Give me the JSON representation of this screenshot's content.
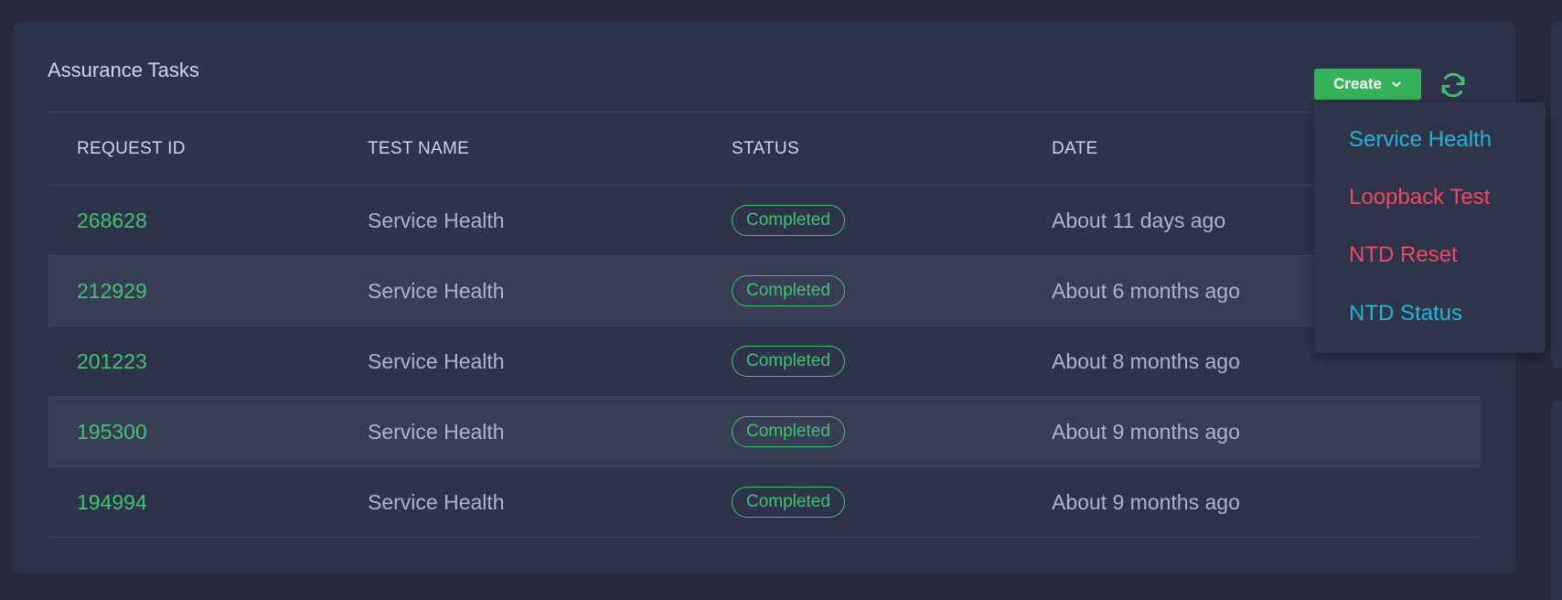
{
  "card": {
    "title": "Assurance Tasks"
  },
  "toolbar": {
    "create_label": "Create",
    "create_icon": "chevron-down-icon",
    "refresh_icon": "refresh-icon"
  },
  "table": {
    "columns": [
      "REQUEST ID",
      "TEST NAME",
      "STATUS",
      "DATE"
    ],
    "rows": [
      {
        "request_id": "268628",
        "test_name": "Service Health",
        "status": "Completed",
        "date": "About 11 days ago"
      },
      {
        "request_id": "212929",
        "test_name": "Service Health",
        "status": "Completed",
        "date": "About 6 months ago"
      },
      {
        "request_id": "201223",
        "test_name": "Service Health",
        "status": "Completed",
        "date": "About 8 months ago"
      },
      {
        "request_id": "195300",
        "test_name": "Service Health",
        "status": "Completed",
        "date": "About 9 months ago"
      },
      {
        "request_id": "194994",
        "test_name": "Service Health",
        "status": "Completed",
        "date": "About 9 months ago"
      }
    ]
  },
  "dropdown": {
    "items": [
      {
        "label": "Service Health",
        "color": "#1fb6d6"
      },
      {
        "label": "Loopback Test",
        "color": "#ee4a5a"
      },
      {
        "label": "NTD Reset",
        "color": "#ee4a5a"
      },
      {
        "label": "NTD Status",
        "color": "#1fb6d6"
      }
    ]
  },
  "colors": {
    "background": "#262a3b",
    "card": "#2f3349",
    "row_alt": "#393d54",
    "accent_green": "#3ec46d",
    "button_green": "#34b35a",
    "text_primary": "#d0d4e4",
    "text_muted": "#aeb3c8",
    "cyan": "#1fb6d6",
    "red": "#ee4a5a"
  }
}
